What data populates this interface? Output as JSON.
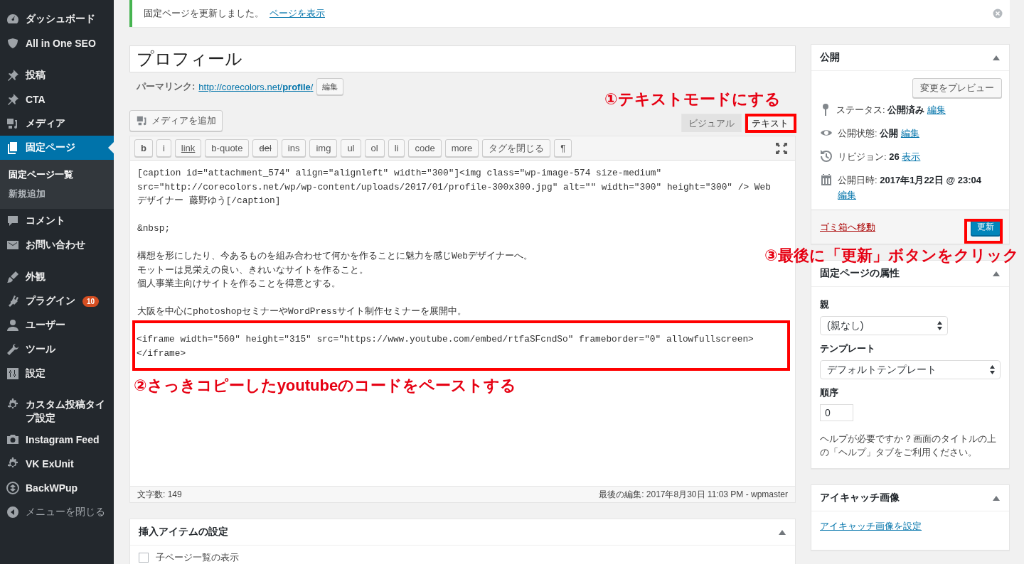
{
  "sidebar": {
    "groups": [
      [
        {
          "label": "ダッシュボード",
          "selected": false
        },
        {
          "label": "All in One SEO",
          "selected": false
        }
      ],
      [
        {
          "label": "投稿",
          "selected": false
        },
        {
          "label": "CTA",
          "selected": false
        },
        {
          "label": "メディア",
          "selected": false
        },
        {
          "label": "固定ページ",
          "selected": true,
          "children": [
            {
              "label": "固定ページ一覧",
              "selected": true
            },
            {
              "label": "新規追加",
              "selected": false
            }
          ]
        },
        {
          "label": "コメント",
          "selected": false
        },
        {
          "label": "お問い合わせ",
          "selected": false
        }
      ],
      [
        {
          "label": "外観",
          "selected": false
        },
        {
          "label": "プラグイン",
          "selected": false,
          "badge": "10"
        },
        {
          "label": "ユーザー",
          "selected": false
        },
        {
          "label": "ツール",
          "selected": false
        },
        {
          "label": "設定",
          "selected": false
        }
      ],
      [
        {
          "label": "カスタム投稿タイプ設定",
          "selected": false
        },
        {
          "label": "Instagram Feed",
          "selected": false
        },
        {
          "label": "VK ExUnit",
          "selected": false
        },
        {
          "label": "BackWPup",
          "selected": false
        },
        {
          "label": "メニューを閉じる",
          "selected": false,
          "kind": "collapse"
        }
      ]
    ]
  },
  "notice": {
    "message": "固定ページを更新しました。",
    "link": "ページを表示"
  },
  "editor": {
    "title": "プロフィール",
    "permalink_label": "パーマリンク:",
    "permalink_url": "http://corecolors.net/",
    "permalink_slug": "profile",
    "permalink_end": "/",
    "permalink_edit": "編集",
    "media_button": "メディアを追加",
    "tabs": [
      {
        "label": "ビジュアル",
        "selected": false
      },
      {
        "label": "テキスト",
        "selected": true
      }
    ],
    "toolbar": [
      {
        "label": "b",
        "kind": "bold"
      },
      {
        "label": "i",
        "kind": "plain"
      },
      {
        "label": "link",
        "kind": "link"
      },
      {
        "label": "b-quote",
        "kind": "plain"
      },
      {
        "label": "del",
        "kind": "strike"
      },
      {
        "label": "ins",
        "kind": "plain"
      },
      {
        "label": "img",
        "kind": "plain"
      },
      {
        "label": "ul",
        "kind": "plain"
      },
      {
        "label": "ol",
        "kind": "plain"
      },
      {
        "label": "li",
        "kind": "plain"
      },
      {
        "label": "code",
        "kind": "plain"
      },
      {
        "label": "more",
        "kind": "plain"
      },
      {
        "label": "タグを閉じる",
        "kind": "plain"
      },
      {
        "label": "¶",
        "kind": "plain"
      }
    ],
    "content": [
      {
        "lines": [
          "[caption id=\"attachment_574\" align=\"alignleft\" width=\"300\"]<img class=\"wp-image-574 size-medium\"",
          "src=\"http://corecolors.net/wp/wp-content/uploads/2017/01/profile-300x300.jpg\" alt=\"\" width=\"300\" height=\"300\" /> Web",
          "デザイナー 藤野ゆう[/caption]"
        ]
      },
      {
        "lines": [
          "&nbsp;"
        ]
      },
      {
        "lines": [
          "構想を形にしたり、今あるものを組み合わせて何かを作ることに魅力を感じWebデザイナーへ。",
          "モットーは見栄えの良い、きれいなサイトを作ること。",
          "個人事業主向けサイトを作ることを得意とする。"
        ]
      },
      {
        "lines": [
          "大阪を中心にphotoshopセミナーやWordPressサイト制作セミナーを展開中。"
        ]
      },
      {
        "highlighted": true,
        "lines": [
          "<iframe width=\"560\" height=\"315\" src=\"https://www.youtube.com/embed/rtfaSFcndSo\" frameborder=\"0\" allowfullscreen>",
          "</iframe>"
        ]
      }
    ],
    "word_count": "文字数: 149",
    "last_edit": "最後の編集: 2017年8月30日 11:03 PM - wpmaster"
  },
  "insert_box": {
    "title": "挿入アイテムの設定",
    "options": [
      {
        "label": "子ページ一覧の表示",
        "checked": false
      }
    ]
  },
  "publish": {
    "title": "公開",
    "preview_button": "変更をプレビュー",
    "rows": [
      {
        "label": "ステータス:",
        "value": "公開済み",
        "link": "編集"
      },
      {
        "label": "公開状態:",
        "value": "公開",
        "link": "編集"
      },
      {
        "label": "リビジョン:",
        "value": "26",
        "link": "表示"
      },
      {
        "label": "公開日時:",
        "value": "2017年1月22日 @ 23:04",
        "link": "編集"
      }
    ],
    "trash_link": "ゴミ箱へ移動",
    "update_button": "更新"
  },
  "attributes": {
    "title": "固定ページの属性",
    "fields": [
      {
        "label": "親",
        "kind": "select",
        "value": "(親なし)"
      },
      {
        "label": "テンプレート",
        "kind": "select",
        "value": "デフォルトテンプレート"
      },
      {
        "label": "順序",
        "kind": "number",
        "value": "0"
      }
    ],
    "help": "ヘルプが必要ですか ? 画面のタイトルの上の「ヘルプ」タブをご利用ください。"
  },
  "featured_image": {
    "title": "アイキャッチ画像",
    "link": "アイキャッチ画像を設定"
  },
  "annotations": [
    {
      "text": "①テキストモードにする"
    },
    {
      "text": "②さっきコピーしたyoutubeのコードをペーストする"
    },
    {
      "text": "③最後に「更新」ボタンをクリック"
    }
  ]
}
